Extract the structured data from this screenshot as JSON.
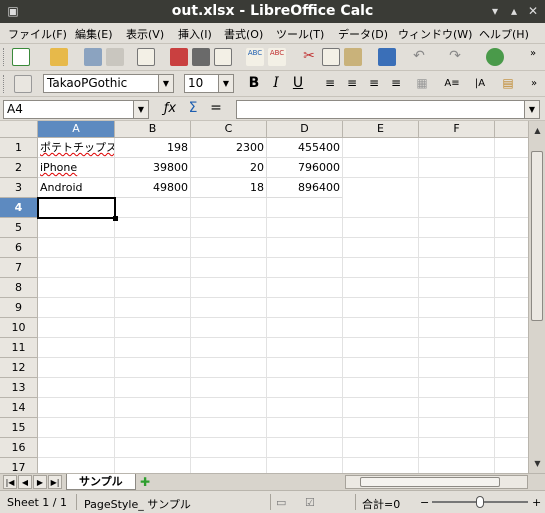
{
  "window": {
    "title": "out.xlsx - LibreOffice Calc"
  },
  "menu": [
    "ファイル(F)",
    "編集(E)",
    "表示(V)",
    "挿入(I)",
    "書式(O)",
    "ツール(T)",
    "データ(D)",
    "ウィンドウ(W)",
    "ヘルプ(H)"
  ],
  "formatting": {
    "font_name": "TakaoPGothic",
    "font_size": "10",
    "bold_label": "B",
    "italic_label": "I",
    "underline_label": "U"
  },
  "formula_bar": {
    "cell_reference": "A4",
    "formula_value": "",
    "sum_symbol": "Σ",
    "equals_symbol": "="
  },
  "columns": [
    "A",
    "B",
    "C",
    "D",
    "E",
    "F"
  ],
  "rows": [
    "1",
    "2",
    "3",
    "4",
    "5",
    "6",
    "7",
    "8",
    "9",
    "10",
    "11",
    "12",
    "13",
    "14",
    "15",
    "16",
    "17"
  ],
  "cells": [
    [
      "ポテトチップス",
      "198",
      "2300",
      "455400"
    ],
    [
      "iPhone",
      "39800",
      "20",
      "796000"
    ],
    [
      "Android",
      "49800",
      "18",
      "896400"
    ]
  ],
  "selected": {
    "column": "A",
    "row": "4"
  },
  "sheet_tabs": {
    "active": "サンプル"
  },
  "status": {
    "sheet": "Sheet 1 / 1",
    "page_style": "PageStyle_ サンプル",
    "sum": "合計=0",
    "zoom_minus": "−",
    "zoom_plus": "+"
  },
  "colors": {
    "selection_header": "#5d8ac0",
    "title_bar": "#3a3b36"
  }
}
